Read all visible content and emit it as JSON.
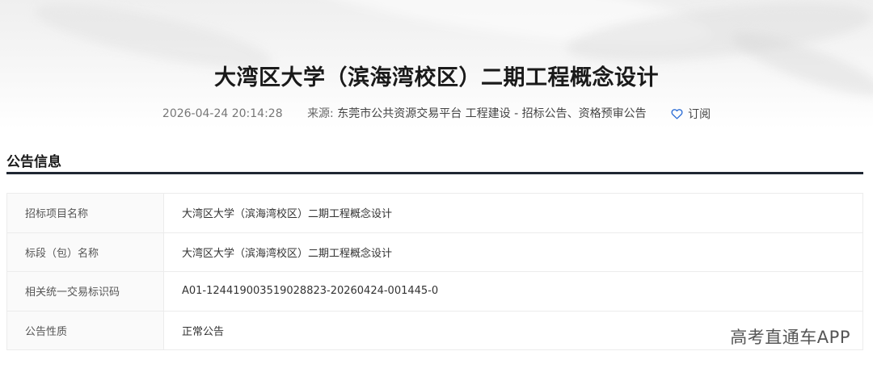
{
  "header": {
    "title": "大湾区大学（滨海湾校区）二期工程概念设计",
    "datetime": "2026-04-24 20:14:28",
    "source_label": "来源:",
    "source_value": "东莞市公共资源交易平台 工程建设 - 招标公告、资格预审公告",
    "subscribe_label": "订阅",
    "subscribe_icon": "heart-icon",
    "accent_color": "#2f6fd6"
  },
  "section": {
    "title": "公告信息",
    "rule_color": "#1f2733"
  },
  "info_rows": [
    {
      "key": "招标项目名称",
      "value": "大湾区大学（滨海湾校区）二期工程概念设计"
    },
    {
      "key": "标段（包）名称",
      "value": "大湾区大学（滨海湾校区）二期工程概念设计"
    },
    {
      "key": "相关统一交易标识码",
      "value": "A01-124419003519028823-20260424-001445-0"
    },
    {
      "key": "公告性质",
      "value": "正常公告"
    }
  ],
  "watermark": "高考直通车APP"
}
